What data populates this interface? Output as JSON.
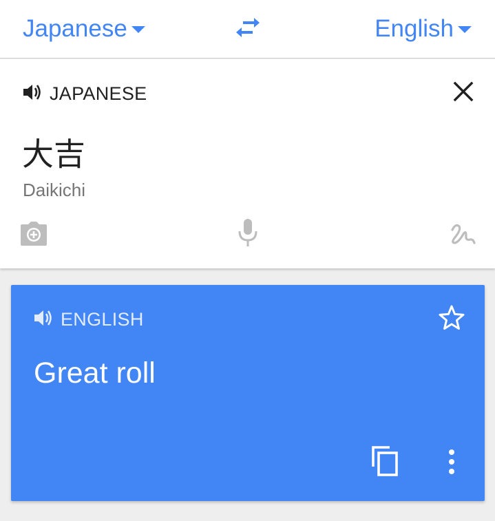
{
  "top_bar": {
    "source_language": "Japanese",
    "target_language": "English",
    "icons": {
      "swap": "swap-arrows-icon",
      "dropdown": "caret-down-icon"
    }
  },
  "input_card": {
    "language_label": "JAPANESE",
    "source_text": "大吉",
    "romanization": "Daikichi",
    "icons": {
      "speaker": "speaker-icon",
      "close": "close-icon",
      "camera": "camera-icon",
      "mic": "microphone-icon",
      "handwriting": "handwriting-icon"
    }
  },
  "output_card": {
    "language_label": "ENGLISH",
    "translation": "Great roll",
    "icons": {
      "speaker": "speaker-icon",
      "star": "star-outline-icon",
      "copy": "copy-icon",
      "more": "more-vert-icon"
    }
  },
  "colors": {
    "accent": "#4285f4",
    "output_background": "#4285f4",
    "page_background": "#eeeeee",
    "icon_grey": "#bdbdbd"
  }
}
